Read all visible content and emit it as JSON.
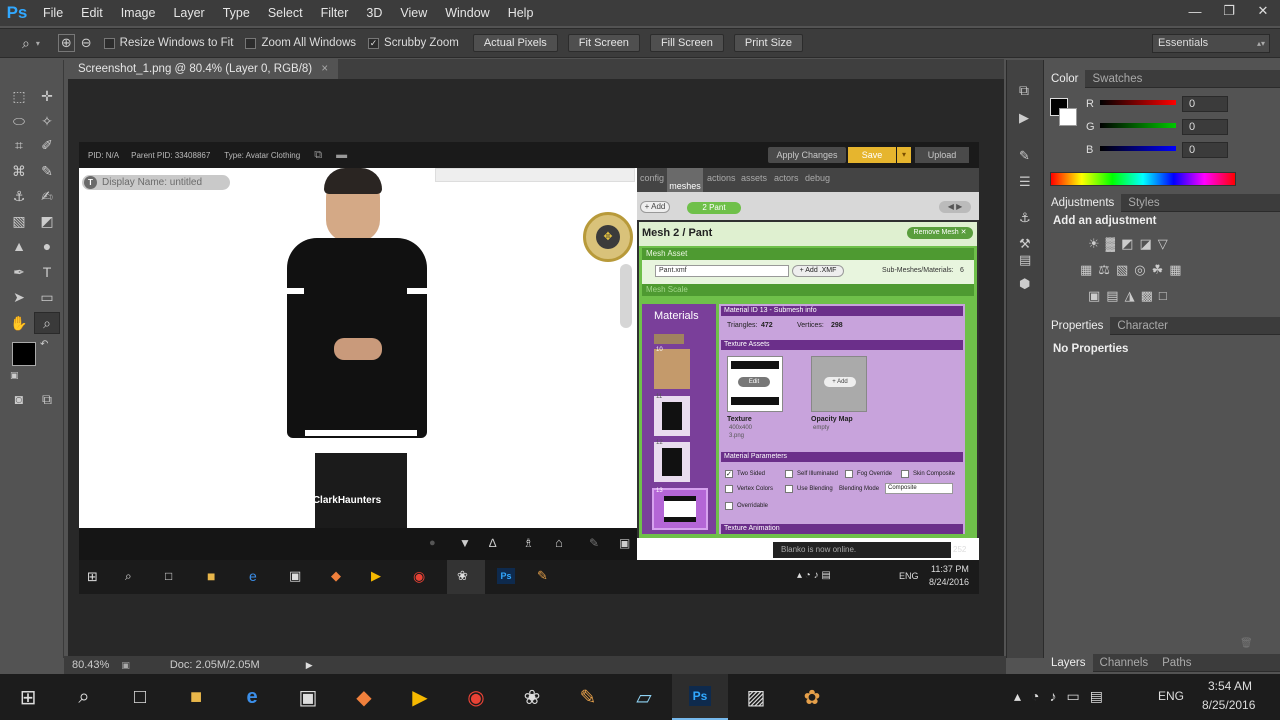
{
  "app": {
    "logo": "Ps"
  },
  "menu": [
    "File",
    "Edit",
    "Image",
    "Layer",
    "Type",
    "Select",
    "Filter",
    "3D",
    "View",
    "Window",
    "Help"
  ],
  "window_controls": {
    "minimize": "—",
    "restore": "❐",
    "close": "✕"
  },
  "options": {
    "resize_windows": "Resize Windows to Fit",
    "zoom_all": "Zoom All Windows",
    "scrubby": "Scrubby Zoom",
    "scrubby_checked": "✓",
    "actual_pixels": "Actual Pixels",
    "fit_screen": "Fit Screen",
    "fill_screen": "Fill Screen",
    "print_size": "Print Size",
    "workspace": "Essentials"
  },
  "document": {
    "tab_title": "Screenshot_1.png @ 80.4% (Layer 0, RGB/8)",
    "tab_close": "×"
  },
  "status": {
    "zoom": "80.43%",
    "doc": "Doc: 2.05M/2.05M"
  },
  "color_panel": {
    "tabs": [
      "Color",
      "Swatches"
    ],
    "r_label": "R",
    "g_label": "G",
    "b_label": "B",
    "r_value": "0",
    "g_value": "0",
    "b_value": "0"
  },
  "adjustments_panel": {
    "tabs": [
      "Adjustments",
      "Styles"
    ],
    "heading": "Add an adjustment"
  },
  "properties_panel": {
    "tabs": [
      "Properties",
      "Character"
    ],
    "text": "No Properties"
  },
  "layers_panel": {
    "tabs": [
      "Layers",
      "Channels",
      "Paths"
    ]
  },
  "embedded": {
    "pid": "PID: N/A",
    "parent_pid": "Parent PID: 33408867",
    "type": "Type: Avatar Clothing",
    "apply_changes": "Apply Changes",
    "save": "Save",
    "upload": "Upload",
    "display_name": "Display Name: untitled",
    "tabs": [
      "config",
      "meshes",
      "actions",
      "assets",
      "actors",
      "debug"
    ],
    "add": "+ Add",
    "mesh_chip": "2 Pant",
    "mesh_title": "Mesh 2 / Pant",
    "remove_mesh": "Remove Mesh ✕",
    "mesh_asset": "Mesh Asset",
    "mesh_file": "Pant.xmf",
    "add_xmf": "+ Add .XMF",
    "submeshes": "Sub-Meshes/Materials:",
    "submesh_count": "6",
    "mesh_scale": "Mesh Scale",
    "materials": "Materials",
    "material_id": "Material ID 13 - Submesh info",
    "triangles_label": "Triangles:",
    "triangles": "472",
    "vertices_label": "Vertices:",
    "vertices": "298",
    "texture_assets": "Texture Assets",
    "edit": "Edit",
    "texture": "Texture",
    "texture_size": "400x400",
    "texture_file": "3.png",
    "add_small": "+ Add",
    "opacity_map": "Opacity Map",
    "opacity_state": "empty",
    "material_params": "Material Parameters",
    "two_sided": "Two Sided",
    "self_illum": "Self Illuminated",
    "fog_override": "Fog Override",
    "skin_composite": "Skin Composite",
    "vertex_colors": "Vertex Colors",
    "use_blending": "Use Blending",
    "blending_mode": "Blending Mode",
    "blend_value": "Composite",
    "overridable": "Overridable",
    "texture_anim": "Texture Animation",
    "username": "ClarkHaunters",
    "notice": "Blanko is now online.",
    "online_count": "252",
    "mat_numbers": [
      "10",
      "11",
      "12",
      "13"
    ],
    "inner_lang": "ENG",
    "inner_time": "11:37 PM",
    "inner_date": "8/24/2016"
  },
  "taskbar": {
    "lang": "ENG",
    "time": "3:54 AM",
    "date": "8/25/2016"
  }
}
